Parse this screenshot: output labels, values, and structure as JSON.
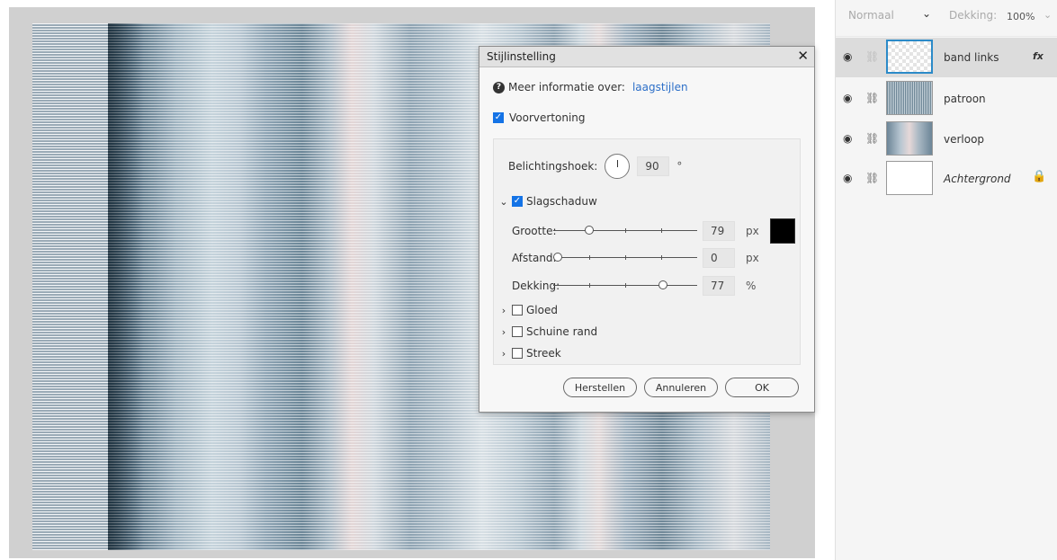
{
  "dialog": {
    "title": "Stijlinstelling",
    "close_glyph": "✕",
    "info_text": "Meer informatie over:",
    "info_link": "laagstijlen",
    "preview_label": "Voorvertoning",
    "preview_checked": true,
    "light_angle_label": "Belichtingshoek:",
    "light_angle_value": "90",
    "light_angle_unit": "°",
    "drop_shadow": {
      "label": "Slagschaduw",
      "checked": true,
      "expanded": true,
      "size_label": "Grootte:",
      "size_value": "79",
      "size_unit": "px",
      "distance_label": "Afstand:",
      "distance_value": "0",
      "distance_unit": "px",
      "opacity_label": "Dekking:",
      "opacity_value": "77",
      "opacity_unit": "%",
      "color": "#000000"
    },
    "sections": [
      {
        "label": "Gloed",
        "checked": false
      },
      {
        "label": "Schuine rand",
        "checked": false
      },
      {
        "label": "Streek",
        "checked": false
      }
    ],
    "buttons": {
      "reset": "Herstellen",
      "cancel": "Annuleren",
      "ok": "OK"
    }
  },
  "layers_panel": {
    "blend_mode": "Normaal",
    "opacity_label": "Dekking:",
    "opacity_value": "100%",
    "layers": [
      {
        "name": "band links",
        "selected": true,
        "fx": "fx",
        "icon": "transparent-thumbnail"
      },
      {
        "name": "patroon",
        "selected": false,
        "icon": "stripe-pattern-thumbnail"
      },
      {
        "name": "verloop",
        "selected": false,
        "icon": "gradient-thumbnail"
      },
      {
        "name": "Achtergrond",
        "selected": false,
        "italic": true,
        "icon": "white-thumbnail",
        "locked": true
      }
    ]
  }
}
